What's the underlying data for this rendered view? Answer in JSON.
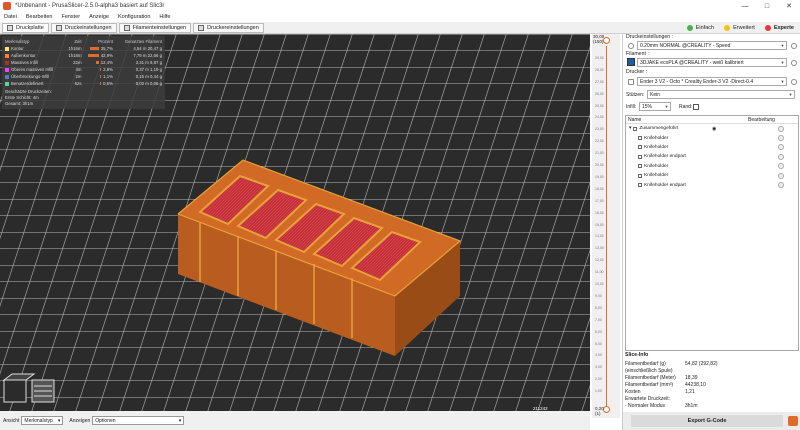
{
  "window": {
    "title": "*Unbenannt - PrusaSlicer-2.5.0-alpha3 basiert auf Slic3r",
    "controls": [
      "—",
      "□",
      "✕"
    ]
  },
  "menubar": [
    "Datei",
    "Bearbeiten",
    "Fenster",
    "Anzeige",
    "Konfiguration",
    "Hilfe"
  ],
  "tabs": [
    "Druckplatte",
    "Druckeinstellungen",
    "Filamenteinstellungen",
    "Druckereinstellungen"
  ],
  "modes": [
    {
      "label": "Einfach",
      "color": "#4caf50"
    },
    {
      "label": "Erweitert",
      "color": "#f2c40e"
    },
    {
      "label": "Experte",
      "color": "#e53935"
    }
  ],
  "legend": {
    "title": "Merkmalstyp",
    "headers": [
      "Zeit",
      "Prozent",
      "Genutztes Filament"
    ],
    "rows": [
      {
        "name": "Kontur",
        "time": "1h16m",
        "pct": "35,7%",
        "fill": 0.357,
        "fil_m": "4,54 m",
        "fil_g": "20,47 g",
        "color": "#ffe666"
      },
      {
        "name": "Außenkontur",
        "time": "1h18m",
        "pct": "42,9%",
        "fill": 0.429,
        "fil_m": "7,79 m",
        "fil_g": "22,66 g",
        "color": "#ff7c38"
      },
      {
        "name": "Massives Infill",
        "time": "22m",
        "pct": "12,4%",
        "fill": 0.124,
        "fil_m": "3,31 m",
        "fil_g": "9,87 g",
        "color": "#b03029"
      },
      {
        "name": "Oberes massives Infill",
        "time": "4m",
        "pct": "2,8%",
        "fill": 0.028,
        "fil_m": "0,37 m",
        "fil_g": "1,19 g",
        "color": "#f040ff"
      },
      {
        "name": "Überbrückungs-Infill",
        "time": "2m",
        "pct": "1,1%",
        "fill": 0.011,
        "fil_m": "0,15 m",
        "fil_g": "0,44 g",
        "color": "#4d80ba"
      },
      {
        "name": "Benutzerdefiniert",
        "time": "52s",
        "pct": "0,5%",
        "fill": 0.005,
        "fil_m": "0,02 m",
        "fil_g": "0,06 g",
        "color": "#5ed194"
      }
    ],
    "footer_title": "Geschätzte Druckzeiten:",
    "footer": [
      {
        "k": "Erste Schicht:",
        "v": "4m"
      },
      {
        "k": "Gesamt:",
        "v": "3h1m"
      }
    ]
  },
  "viewport_bottom": {
    "view_label": "Ansicht",
    "view_value": "Merkmalstyp",
    "show_label": "Anzeigen",
    "show_value": "Optionen"
  },
  "hslider": {
    "left_value": "210311",
    "right_value": "211242"
  },
  "vslider": {
    "top_value": "30,00",
    "top_layer": "(150)",
    "bottom_value": "0,20",
    "bottom_layer": "(1)",
    "ticks": [
      "29,00",
      "28,00",
      "27,00",
      "26,00",
      "25,00",
      "24,00",
      "23,00",
      "22,00",
      "21,00",
      "20,00",
      "19,00",
      "18,00",
      "17,00",
      "16,00",
      "15,00",
      "14,00",
      "13,00",
      "12,00",
      "11,00",
      "10,00",
      "9,00",
      "8,00",
      "7,00",
      "6,00",
      "5,00",
      "4,00",
      "3,00",
      "2,00",
      "1,00"
    ]
  },
  "sidebar": {
    "print_settings_label": "Druckeinstellungen :",
    "print_settings_value": "0.20mm NORMAL @CREALITY - Speed",
    "filament_label": "Filament :",
    "filament_value": "3DJAKE ecoPLA @CREALITY - weiß kalibriert",
    "filament_color": "#1a5fa0",
    "printer_label": "Drucker :",
    "printer_value": "Ender 3 V2 - Octo * Creality Ender-3 V2 -Direct-0.4",
    "supports_label": "Stützen:",
    "supports_value": "Kein",
    "infill_label": "Infill:",
    "infill_value": "15%",
    "brim_label": "Rand:",
    "list_headers": [
      "Name",
      "Bearbeitung"
    ],
    "objects": [
      {
        "name": "Zusammengeführt",
        "level": 0
      },
      {
        "name": "Knifeholder",
        "level": 1
      },
      {
        "name": "Knifeholder",
        "level": 1
      },
      {
        "name": "Knifeholder endpart",
        "level": 1
      },
      {
        "name": "Knifeholder",
        "level": 1
      },
      {
        "name": "Knifeholder",
        "level": 1
      },
      {
        "name": "Knifeholder endpart",
        "level": 1
      }
    ],
    "slice_info": {
      "title": "Slice-Info",
      "rows": [
        {
          "k": "Filamentbedarf (g)",
          "v": "54,82 (292,82)"
        },
        {
          "k": "(einschließlich Spule)",
          "v": ""
        },
        {
          "k": "Filamentbedarf (Meter)",
          "v": "18,39"
        },
        {
          "k": "Filamentbedarf (mm³)",
          "v": "44238,10"
        },
        {
          "k": "Kosten",
          "v": "1,21"
        },
        {
          "k": "Erwartete Druckzeit:",
          "v": ""
        },
        {
          "k": "- Normaler Modus",
          "v": "3h1m"
        }
      ]
    },
    "export_label": "Export G-Code"
  }
}
